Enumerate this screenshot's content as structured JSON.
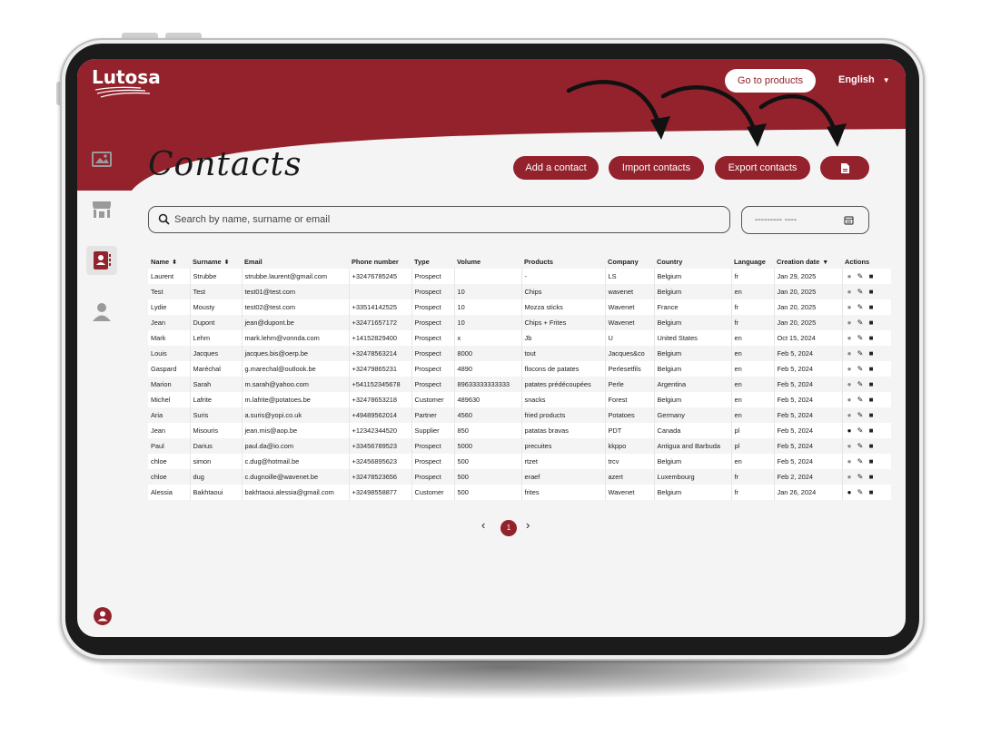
{
  "header": {
    "logo": "Lutosa",
    "go_to_products": "Go to products",
    "language": "English",
    "brand_color": "#93222c"
  },
  "sidebar": {
    "items": [
      {
        "icon": "images-icon"
      },
      {
        "icon": "store-icon"
      },
      {
        "icon": "contacts-icon",
        "active": true
      },
      {
        "icon": "user-icon"
      }
    ],
    "bottom_icon": "account-icon"
  },
  "page": {
    "title": "Contacts",
    "buttons": {
      "add": "Add a contact",
      "import": "Import contacts",
      "export": "Export contacts"
    },
    "search_placeholder": "Search by name, surname or email",
    "date_placeholder": "--------- ----"
  },
  "table": {
    "columns": [
      "Name",
      "Surname",
      "Email",
      "Phone number",
      "Type",
      "Volume",
      "Products",
      "Company",
      "Country",
      "Language",
      "Creation date",
      "Actions"
    ],
    "rows": [
      [
        "Laurent",
        "Strubbe",
        "strubbe.laurent@gmail.com",
        "+32476785245",
        "Prospect",
        "",
        "-",
        "LS",
        "Belgium",
        "fr",
        "Jan 29, 2025"
      ],
      [
        "Test",
        "Test",
        "test01@test.com",
        "",
        "Prospect",
        "10",
        "Chips",
        "wavenet",
        "Belgium",
        "en",
        "Jan 20, 2025"
      ],
      [
        "Lydie",
        "Mousty",
        "test02@test.com",
        "+33514142525",
        "Prospect",
        "10",
        "Mozza sticks",
        "Wavenet",
        "France",
        "fr",
        "Jan 20, 2025"
      ],
      [
        "Jean",
        "Dupont",
        "jean@dupont.be",
        "+32471657172",
        "Prospect",
        "10",
        "Chips + Frites",
        "Wavenet",
        "Belgium",
        "fr",
        "Jan 20, 2025"
      ],
      [
        "Mark",
        "Lehm",
        "mark.lehm@vonnda.com",
        "+14152829400",
        "Prospect",
        "x",
        "Jb",
        "U",
        "United States",
        "en",
        "Oct 15, 2024"
      ],
      [
        "Louis",
        "Jacques",
        "jacques.bis@oerp.be",
        "+32478563214",
        "Prospect",
        "8000",
        "tout",
        "Jacques&co",
        "Belgium",
        "en",
        "Feb 5, 2024"
      ],
      [
        "Gaspard",
        "Maréchal",
        "g.marechal@outlook.be",
        "+32479865231",
        "Prospect",
        "4890",
        "flocons de patates",
        "Perlesetfils",
        "Belgium",
        "en",
        "Feb 5, 2024"
      ],
      [
        "Marion",
        "Sarah",
        "m.sarah@yahoo.com",
        "+541152345678",
        "Prospect",
        "89633333333333",
        "patates prédécoupées",
        "Perle",
        "Argentina",
        "en",
        "Feb 5, 2024"
      ],
      [
        "Michel",
        "Lafrite",
        "m.lafrite@potatoes.be",
        "+32478653218",
        "Customer",
        "489630",
        "snacks",
        "Forest",
        "Belgium",
        "en",
        "Feb 5, 2024"
      ],
      [
        "Aria",
        "Suris",
        "a.suris@yopi.co.uk",
        "+49489562014",
        "Partner",
        "4560",
        "fried products",
        "Potatoes",
        "Germany",
        "en",
        "Feb 5, 2024"
      ],
      [
        "Jean",
        "Misouris",
        "jean.mis@aop.be",
        "+12342344520",
        "Supplier",
        "850",
        "patatas bravas",
        "PDT",
        "Canada",
        "pl",
        "Feb 5, 2024"
      ],
      [
        "Paul",
        "Darius",
        "paul.da@io.com",
        "+33456789523",
        "Prospect",
        "5000",
        "precuites",
        "kkppo",
        "Antigua and Barbuda",
        "pl",
        "Feb 5, 2024"
      ],
      [
        "chloe",
        "simon",
        "c.dug@hotmail.be",
        "+32456895623",
        "Prospect",
        "500",
        "rtzet",
        "trcv",
        "Belgium",
        "en",
        "Feb 5, 2024"
      ],
      [
        "chloe",
        "dug",
        "c.dugnoille@wavenet.be",
        "+32478523656",
        "Prospect",
        "500",
        "eraef",
        "azert",
        "Luxembourg",
        "fr",
        "Feb 2, 2024"
      ],
      [
        "Alessia",
        "Bakhtaoui",
        "bakhtaoui.alessia@gmail.com",
        "+32498558877",
        "Customer",
        "500",
        "frites",
        "Wavenet",
        "Belgium",
        "fr",
        "Jan 26, 2024"
      ]
    ],
    "dark_bubble_rows": [
      10,
      14
    ]
  },
  "pagination": {
    "prev": "‹",
    "current": "1",
    "next": "›"
  }
}
